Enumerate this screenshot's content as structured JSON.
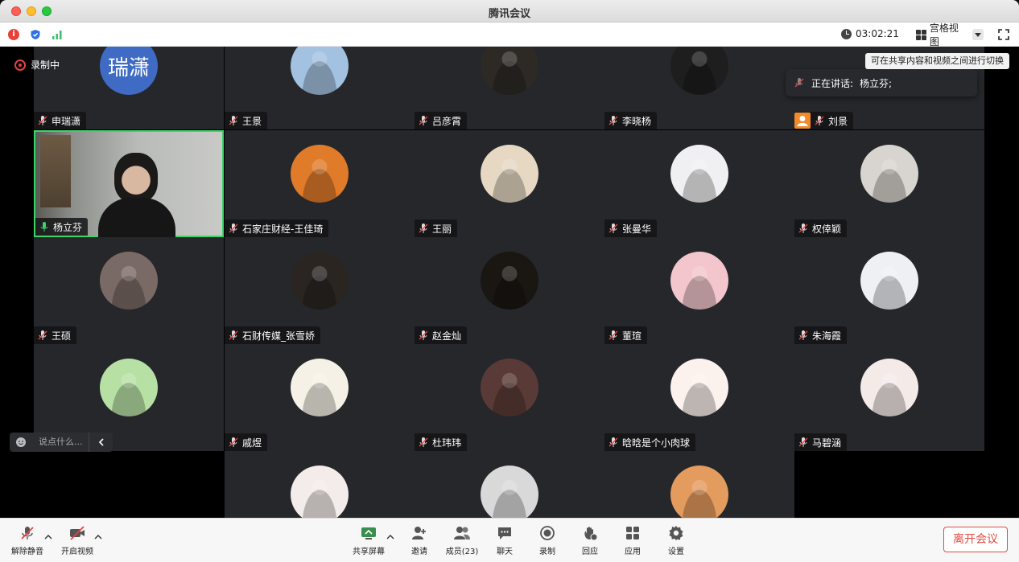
{
  "window": {
    "title": "腾讯会议"
  },
  "status": {
    "timer": "03:02:21",
    "view_mode": "宫格视图"
  },
  "recording_label": "录制中",
  "tooltip": "可在共享内容和视频之间进行切换",
  "speaking": {
    "label": "正在讲话:",
    "name": "杨立芬;"
  },
  "reaction": {
    "chat_placeholder": "说点什么..."
  },
  "participants": [
    {
      "name": "申瑞潇",
      "avatar_text": "瑞潇",
      "color": "#3f6bc4",
      "mic": "off"
    },
    {
      "name": "王景",
      "avatar_text": "",
      "color": "#a3c1e0",
      "mic": "off"
    },
    {
      "name": "吕彦霄",
      "avatar_text": "",
      "color": "#2d2a26",
      "mic": "off"
    },
    {
      "name": "李晓杨",
      "avatar_text": "",
      "color": "#1e1e1e",
      "mic": "off"
    },
    {
      "name": "刘景",
      "avatar_text": "",
      "color": "#25272b",
      "mic": "off",
      "badge": "person-icon"
    },
    {
      "name": "杨立芬",
      "avatar_text": "",
      "color": "#8b8e90",
      "mic": "on",
      "video": true
    },
    {
      "name": "石家庄财经-王佳琦",
      "avatar_text": "",
      "color": "#e07b2a",
      "mic": "off"
    },
    {
      "name": "王丽",
      "avatar_text": "",
      "color": "#e6d8c3",
      "mic": "off"
    },
    {
      "name": "张曼华",
      "avatar_text": "",
      "color": "#f0f0f2",
      "mic": "off"
    },
    {
      "name": "权倖颖",
      "avatar_text": "",
      "color": "#d8d4cf",
      "mic": "off"
    },
    {
      "name": "王硕",
      "avatar_text": "",
      "color": "#7a6a66",
      "mic": "off"
    },
    {
      "name": "石财传媒_张雪娇",
      "avatar_text": "",
      "color": "#2b2522",
      "mic": "off"
    },
    {
      "name": "赵金灿",
      "avatar_text": "",
      "color": "#1a1611",
      "mic": "off"
    },
    {
      "name": "董瑄",
      "avatar_text": "",
      "color": "#f2c6cc",
      "mic": "off"
    },
    {
      "name": "朱海霞",
      "avatar_text": "",
      "color": "#eef0f4",
      "mic": "off"
    },
    {
      "name": "",
      "avatar_text": "",
      "color": "#b7e0a4",
      "mic": "off"
    },
    {
      "name": "戚煜",
      "avatar_text": "",
      "color": "#f6f1e6",
      "mic": "off"
    },
    {
      "name": "杜玮玮",
      "avatar_text": "",
      "color": "#5a3a36",
      "mic": "off"
    },
    {
      "name": "晗晗是个小肉球",
      "avatar_text": "",
      "color": "#fbf2ee",
      "mic": "off"
    },
    {
      "name": "马碧涵",
      "avatar_text": "",
      "color": "#f4ebe9",
      "mic": "off"
    },
    {
      "name": "",
      "avatar_text": "",
      "color": "#f4ecea",
      "mic": "off"
    },
    {
      "name": "",
      "avatar_text": "",
      "color": "#d9d9d9",
      "mic": "off"
    },
    {
      "name": "",
      "avatar_text": "",
      "color": "#e49b5e",
      "mic": "off"
    }
  ],
  "toolbar": {
    "unmute": "解除静音",
    "start_video": "开启视频",
    "share_screen": "共享屏幕",
    "invite": "邀请",
    "members": "成员(23)",
    "chat": "聊天",
    "record": "录制",
    "reactions": "回应",
    "apps": "应用",
    "settings": "设置",
    "leave": "离开会议"
  }
}
